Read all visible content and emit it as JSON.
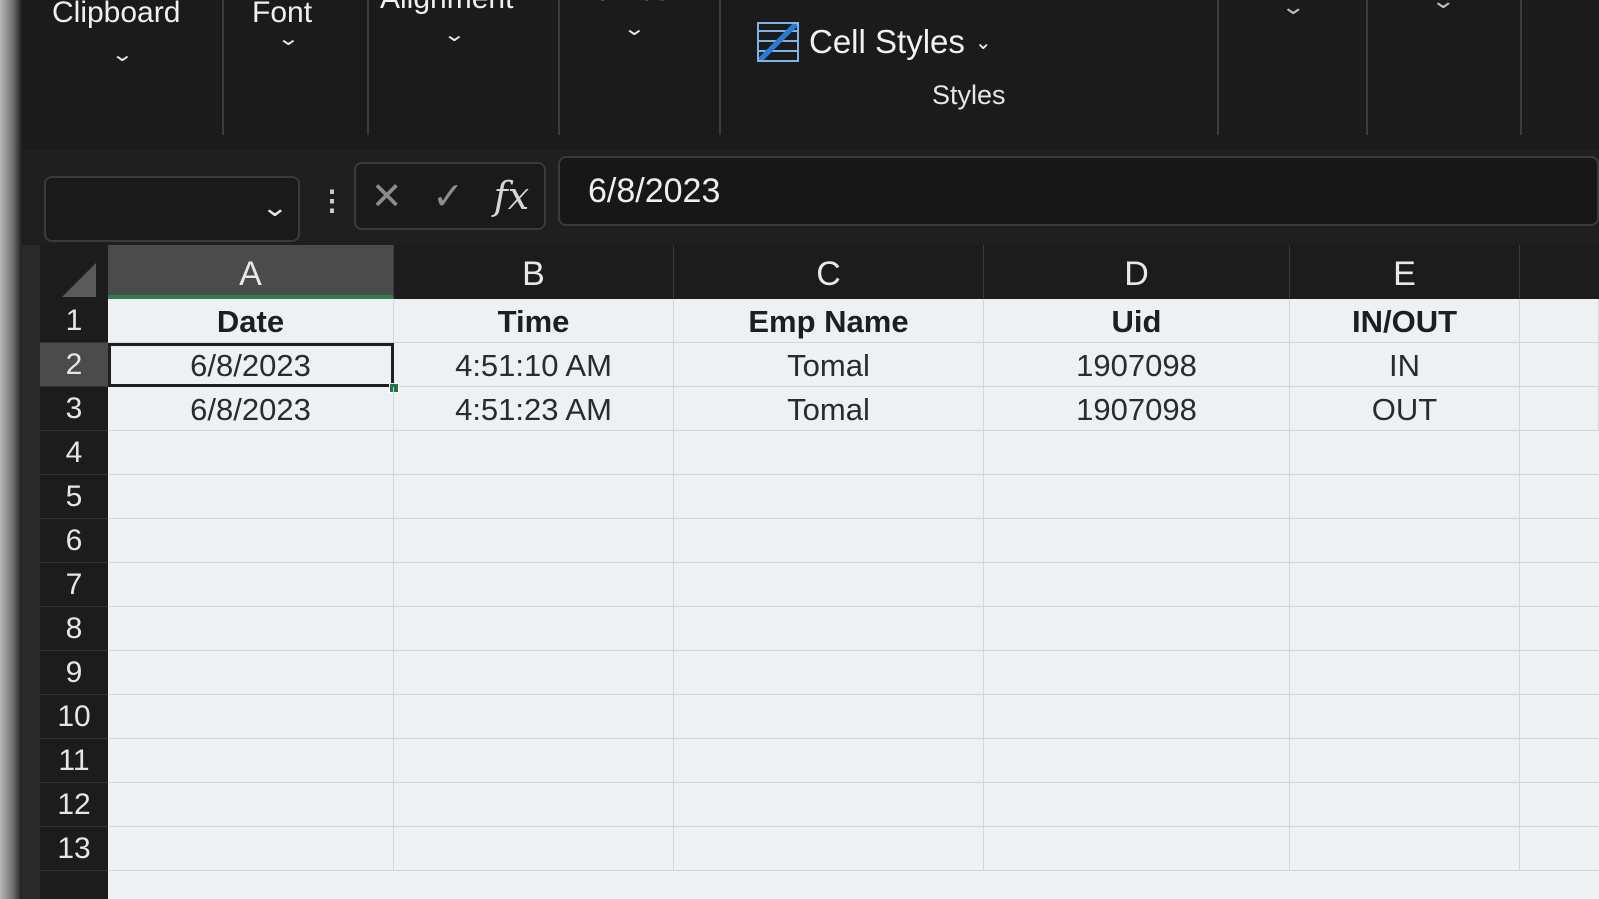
{
  "ribbon": {
    "groups": [
      {
        "label": "Clipboard"
      },
      {
        "label": "Font"
      },
      {
        "label": "Alignment"
      },
      {
        "label": "Number"
      }
    ],
    "cell_styles_label": "Cell Styles",
    "styles_group_label": "Styles",
    "icons": [
      "chevron-down-icon",
      "cell-styles-icon"
    ]
  },
  "formula_bar": {
    "name_box": "",
    "cancel_icon": "✕",
    "enter_icon": "✓",
    "fx_label": "fx",
    "value": "6/8/2023"
  },
  "sheet": {
    "columns": [
      "A",
      "B",
      "C",
      "D",
      "E"
    ],
    "active_column": "A",
    "rows": [
      "1",
      "2",
      "3",
      "4",
      "5",
      "6",
      "7",
      "8",
      "9",
      "10",
      "11",
      "12",
      "13"
    ],
    "active_row": "2",
    "data": [
      [
        "Date",
        "Time",
        "Emp Name",
        "Uid",
        "IN/OUT"
      ],
      [
        "6/8/2023",
        "4:51:10 AM",
        "Tomal",
        "1907098",
        "IN"
      ],
      [
        "6/8/2023",
        "4:51:23 AM",
        "Tomal",
        "1907098",
        "OUT"
      ]
    ],
    "selected_cell": "A2"
  }
}
